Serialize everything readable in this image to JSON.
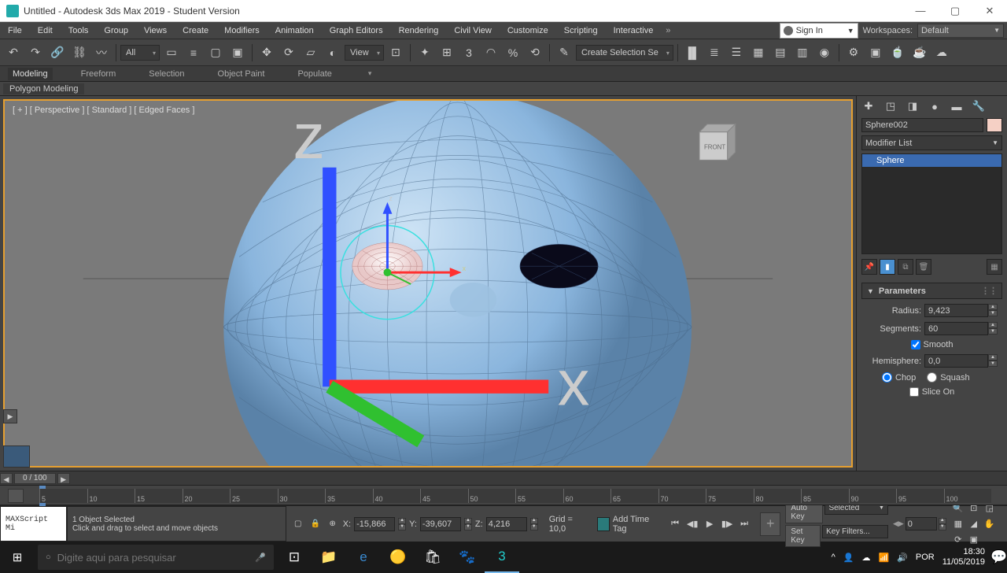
{
  "window": {
    "title": "Untitled - Autodesk 3ds Max 2019 - Student Version"
  },
  "menubar": {
    "items": [
      "File",
      "Edit",
      "Tools",
      "Group",
      "Views",
      "Create",
      "Modifiers",
      "Animation",
      "Graph Editors",
      "Rendering",
      "Civil View",
      "Customize",
      "Scripting",
      "Interactive"
    ],
    "signin": "Sign In",
    "workspaces_label": "Workspaces:",
    "workspaces_value": "Default"
  },
  "toolbar": {
    "filter_all": "All",
    "view_label": "View",
    "selset": "Create Selection Se"
  },
  "ribbon": {
    "tabs": [
      "Modeling",
      "Freeform",
      "Selection",
      "Object Paint",
      "Populate"
    ],
    "active": 0,
    "subpanel": "Polygon Modeling"
  },
  "viewport": {
    "label": "[ + ] [ Perspective ] [ Standard ] [ Edged Faces ]",
    "cube_face": "FRONT"
  },
  "cmdpanel": {
    "object_name": "Sphere002",
    "modifier_list": "Modifier List",
    "stack_item": "Sphere",
    "rollout": "Parameters",
    "params": {
      "radius_label": "Radius:",
      "radius": "9,423",
      "segments_label": "Segments:",
      "segments": "60",
      "smooth": "Smooth",
      "hemisphere_label": "Hemisphere:",
      "hemisphere": "0,0",
      "chop": "Chop",
      "squash": "Squash",
      "slice_on": "Slice On"
    }
  },
  "timeline": {
    "frame_display": "0 / 100",
    "ticks": [
      "5",
      "10",
      "15",
      "20",
      "25",
      "30",
      "35",
      "40",
      "45",
      "50",
      "55",
      "60",
      "65",
      "70",
      "75",
      "80",
      "85",
      "90",
      "95",
      "100"
    ]
  },
  "statusbar": {
    "script": "MAXScript Mi",
    "selected": "1 Object Selected",
    "hint": "Click and drag to select and move objects",
    "x": "-15,866",
    "y": "-39,607",
    "z": "4,216",
    "grid": "Grid = 10,0",
    "add_time_tag": "Add Time Tag",
    "auto_key": "Auto Key",
    "set_key": "Set Key",
    "selected_drop": "Selected",
    "key_filters": "Key Filters...",
    "cur_frame": "0"
  },
  "taskbar": {
    "search_placeholder": "Digite aqui para pesquisar",
    "lang": "POR",
    "time": "18:30",
    "date": "11/05/2019"
  }
}
